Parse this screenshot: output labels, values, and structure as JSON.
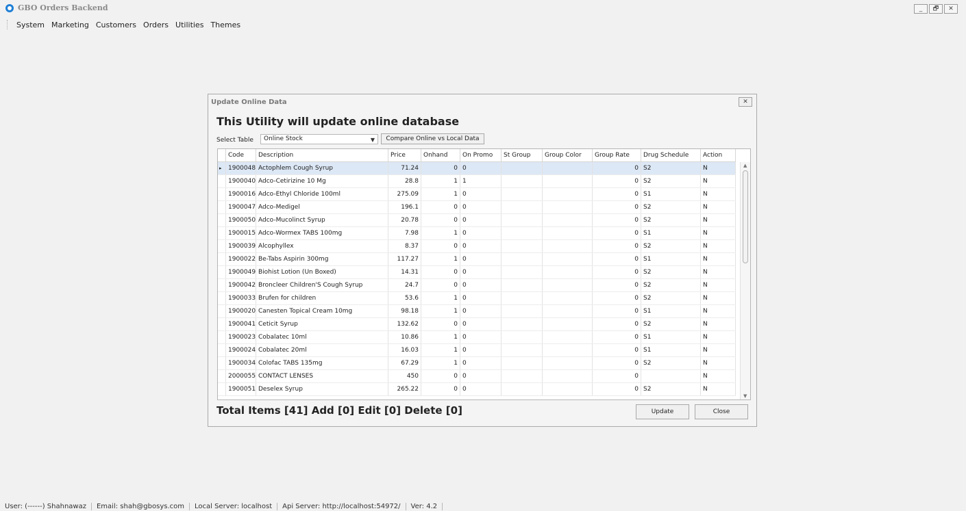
{
  "app": {
    "title": "GBO Orders Backend"
  },
  "menu": [
    "System",
    "Marketing",
    "Customers",
    "Orders",
    "Utilities",
    "Themes"
  ],
  "window_buttons": {
    "minimize": "_",
    "restore": "🗗",
    "close": "✕"
  },
  "dialog": {
    "title": "Update Online Data",
    "close": "✕",
    "heading": "This Utility will update online database",
    "select_label": "Select Table",
    "select_value": "Online Stock",
    "compare_button": "Compare Online vs Local Data",
    "columns": [
      "Code",
      "Description",
      "Price",
      "Onhand",
      "On Promo",
      "St Group",
      "Group Color",
      "Group Rate",
      "Drug Schedule",
      "Action"
    ],
    "rows": [
      {
        "code": "1900048",
        "description": "Actophlem Cough Syrup",
        "price": "71.24",
        "onhand": "0",
        "promo": "0",
        "st_group": "",
        "group_color": "",
        "group_rate": "0",
        "schedule": "S2",
        "action": "N",
        "indicator": "▸"
      },
      {
        "code": "1900040",
        "description": "Adco-Cetirizine 10 Mg",
        "price": "28.8",
        "onhand": "1",
        "promo": "1",
        "st_group": "",
        "group_color": "",
        "group_rate": "0",
        "schedule": "S2",
        "action": "N",
        "indicator": ""
      },
      {
        "code": "1900016",
        "description": "Adco-Ethyl Chloride 100ml",
        "price": "275.09",
        "onhand": "1",
        "promo": "0",
        "st_group": "",
        "group_color": "",
        "group_rate": "0",
        "schedule": "S1",
        "action": "N",
        "indicator": ""
      },
      {
        "code": "1900047",
        "description": "Adco-Medigel",
        "price": "196.1",
        "onhand": "0",
        "promo": "0",
        "st_group": "",
        "group_color": "",
        "group_rate": "0",
        "schedule": "S2",
        "action": "N",
        "indicator": ""
      },
      {
        "code": "1900050",
        "description": "Adco-Mucolinct Syrup",
        "price": "20.78",
        "onhand": "0",
        "promo": "0",
        "st_group": "",
        "group_color": "",
        "group_rate": "0",
        "schedule": "S2",
        "action": "N",
        "indicator": ""
      },
      {
        "code": "1900015",
        "description": "Adco-Wormex TABS 100mg",
        "price": "7.98",
        "onhand": "1",
        "promo": "0",
        "st_group": "",
        "group_color": "",
        "group_rate": "0",
        "schedule": "S1",
        "action": "N",
        "indicator": ""
      },
      {
        "code": "1900039",
        "description": "Alcophyllex",
        "price": "8.37",
        "onhand": "0",
        "promo": "0",
        "st_group": "",
        "group_color": "",
        "group_rate": "0",
        "schedule": "S2",
        "action": "N",
        "indicator": ""
      },
      {
        "code": "1900022",
        "description": "Be-Tabs Aspirin 300mg",
        "price": "117.27",
        "onhand": "1",
        "promo": "0",
        "st_group": "",
        "group_color": "",
        "group_rate": "0",
        "schedule": "S1",
        "action": "N",
        "indicator": ""
      },
      {
        "code": "1900049",
        "description": "Biohist Lotion  (Un Boxed)",
        "price": "14.31",
        "onhand": "0",
        "promo": "0",
        "st_group": "",
        "group_color": "",
        "group_rate": "0",
        "schedule": "S2",
        "action": "N",
        "indicator": ""
      },
      {
        "code": "1900042",
        "description": "Broncleer Children'S Cough Syrup",
        "price": "24.7",
        "onhand": "0",
        "promo": "0",
        "st_group": "",
        "group_color": "",
        "group_rate": "0",
        "schedule": "S2",
        "action": "N",
        "indicator": ""
      },
      {
        "code": "1900033",
        "description": "Brufen for children",
        "price": "53.6",
        "onhand": "1",
        "promo": "0",
        "st_group": "",
        "group_color": "",
        "group_rate": "0",
        "schedule": "S2",
        "action": "N",
        "indicator": ""
      },
      {
        "code": "1900020",
        "description": "Canesten Topical Cream 10mg",
        "price": "98.18",
        "onhand": "1",
        "promo": "0",
        "st_group": "",
        "group_color": "",
        "group_rate": "0",
        "schedule": "S1",
        "action": "N",
        "indicator": ""
      },
      {
        "code": "1900041",
        "description": "Ceticit Syrup",
        "price": "132.62",
        "onhand": "0",
        "promo": "0",
        "st_group": "",
        "group_color": "",
        "group_rate": "0",
        "schedule": "S2",
        "action": "N",
        "indicator": ""
      },
      {
        "code": "1900023",
        "description": "Cobalatec 10ml",
        "price": "10.86",
        "onhand": "1",
        "promo": "0",
        "st_group": "",
        "group_color": "",
        "group_rate": "0",
        "schedule": "S1",
        "action": "N",
        "indicator": ""
      },
      {
        "code": "1900024",
        "description": "Cobalatec 20ml",
        "price": "16.03",
        "onhand": "1",
        "promo": "0",
        "st_group": "",
        "group_color": "",
        "group_rate": "0",
        "schedule": "S1",
        "action": "N",
        "indicator": ""
      },
      {
        "code": "1900034",
        "description": "Colofac TABS 135mg",
        "price": "67.29",
        "onhand": "1",
        "promo": "0",
        "st_group": "",
        "group_color": "",
        "group_rate": "0",
        "schedule": "S2",
        "action": "N",
        "indicator": ""
      },
      {
        "code": "2000055",
        "description": "CONTACT LENSES",
        "price": "450",
        "onhand": "0",
        "promo": "0",
        "st_group": "",
        "group_color": "",
        "group_rate": "0",
        "schedule": "",
        "action": "N",
        "indicator": ""
      },
      {
        "code": "1900051",
        "description": "Deselex Syrup",
        "price": "265.22",
        "onhand": "0",
        "promo": "0",
        "st_group": "",
        "group_color": "",
        "group_rate": "0",
        "schedule": "S2",
        "action": "N",
        "indicator": ""
      }
    ],
    "total_text": "Total Items [41] Add [0] Edit [0] Delete [0]",
    "update_button": "Update",
    "close_button": "Close"
  },
  "status": [
    "User: (------) Shahnawaz",
    "Email: shah@gbosys.com",
    "Local Server: localhost",
    "Api Server: http://localhost:54972/",
    "Ver: 4.2"
  ]
}
